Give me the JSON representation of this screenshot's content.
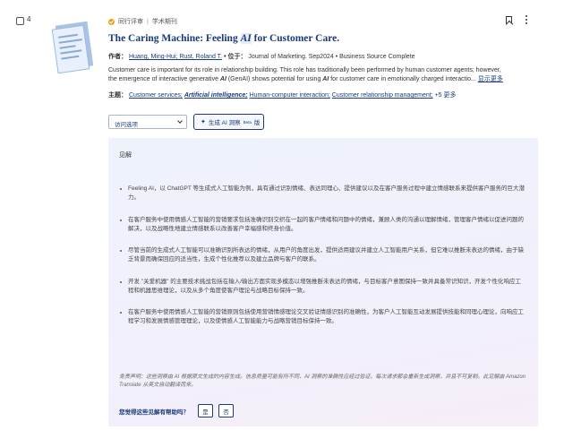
{
  "result": {
    "number": "4",
    "type_label": "同行评审",
    "source_type": "学术期刊",
    "title_pre": "The Caring Machine: Feeling ",
    "title_highlight": "AI",
    "title_post": " for Customer Care.",
    "authors_label": "作者：",
    "authors": "Huang, Ming-Hui; Rust, Roland T.",
    "source_label": "• 位于：",
    "source": "Journal of Marketing. Sep2024 • Business Source Complete",
    "abstract_line1": "Customer care is important for its role in relationship building. This role has traditionally been performed by human customer agents; however,",
    "abstract_line2_pre": "the emergence of interactive generative ",
    "abstract_ai1": "AI",
    "abstract_line2_mid": " (GenAI) shows potential for using ",
    "abstract_ai2": "AI",
    "abstract_line2_post": " for customer care in emotionally charged interactio... ",
    "show_more": "显示更多",
    "subjects_label": "主题：",
    "subjects": [
      "Customer services;",
      "Artificial intelligence;",
      "Human-computer interaction;",
      "Customer relationship management;"
    ],
    "more_subjects": "+5 更多"
  },
  "controls": {
    "access_option": "访问选项",
    "ai_insights_label": "生成 AI 洞察",
    "beta_label": "Beta",
    "ai_insights_suffix": "版"
  },
  "insights_panel": {
    "heading": "见解",
    "items": [
      "Feeling AI，以 ChatGPT 等生成式人工智能为例，具有通过识别情绪、表达同理心、提供建议以及在客户服务过程中建立情感联系来提供客户服务的巨大潜力。",
      "在客户服务中使用情感人工智能的营销要求包括准确识别交织在一起的客户情绪和问题中的情绪，兼顾人类的沟通以理解情绪，管理客户情绪以促进问题的解决，以及战略性地建立情感联系以改善客户幸福感和终身价值。",
      "尽管当前的生成式人工智能可以准确识别所表达的情绪，从用户的角度出发，提供适用建议并建立人工智能用户关系，但它难以推断未表达的情绪，由于缺乏背景而确保回应的适当性，生成个性化推荐以及建立品牌与客户的联系。",
      "开发 \"关爱机器\" 的主要技术挑战包括在输入/输出方面实现多模态以增强推断未表达的情绪，与目标客户意图保持一致并具备常识知识，开发个性化响应工程和机器思维理论，以及从多个角度使客户理论与战略目标保持一致。",
      "在客户服务中使用情感人工智能的营销原则包括使用营销情感理论交叉验证情感识别的准确性，为客户人工智能互动发展提供技能和同理心理论，向响应工程学习和发展情感管理理论，以及使情感人工智能能力与战略营销目标保持一致。"
    ],
    "disclaimer": "免责声明：这些洞察由 AI 根据原文生成的内容生成。信息质量可能有所不同，AI 洞察的准确性应经过验证。每次请求都会重新生成洞察，并且不可复制。此见解由 Amazon Translate 从英文自动翻译而来。",
    "feedback_question": "您觉得这些见解有帮助吗？",
    "yes": "是",
    "no": "否"
  },
  "colors": {
    "link": "#1a3a7a",
    "panel_bg": "#eef2fb",
    "peer_badge": "#e0a51f"
  }
}
